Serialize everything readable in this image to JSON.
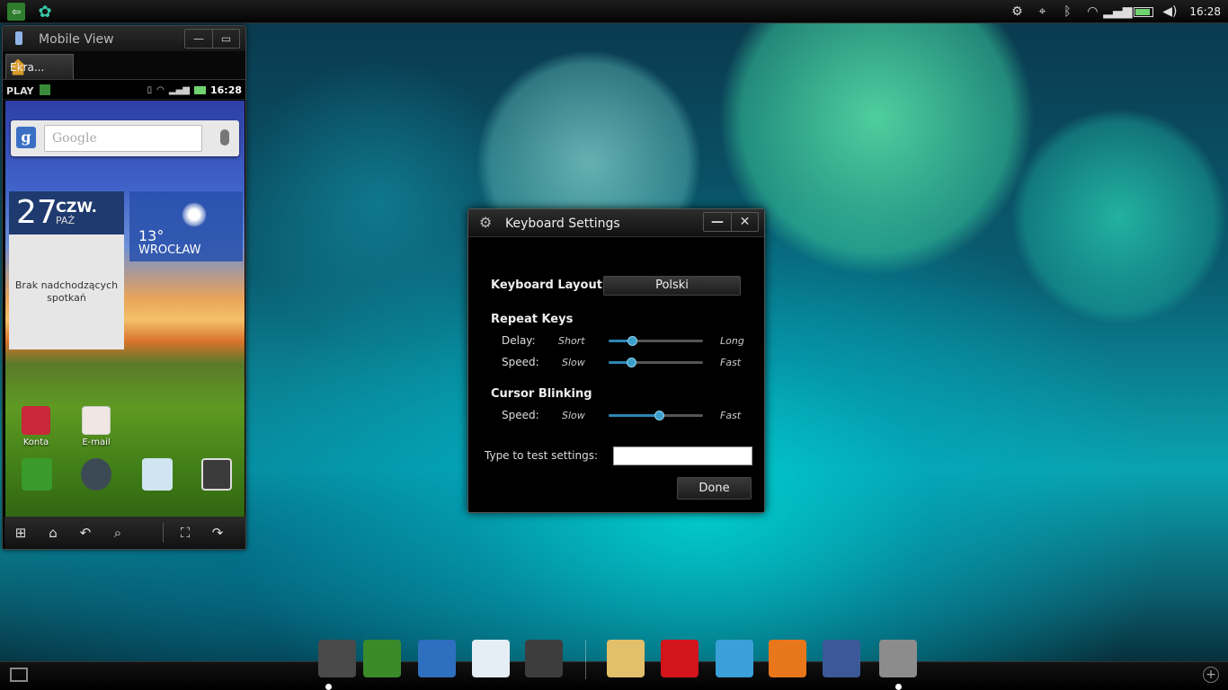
{
  "topbar": {
    "clock": "16:28"
  },
  "mobile_view": {
    "title": "Mobile View",
    "tab_label": "Ekra...",
    "phone_status": {
      "carrier": "PLAY",
      "time": "16:28"
    },
    "search": {
      "placeholder": "Google",
      "logo": "g"
    },
    "date_widget": {
      "day": "27",
      "month_line1": "CZW.",
      "month_line2": "PAŹ",
      "agenda_text": "Brak nadchodzących spotkań"
    },
    "weather": {
      "temp": "13°",
      "city": "WROCŁAW"
    },
    "apps": [
      {
        "label": "Konta"
      },
      {
        "label": "E-mail"
      }
    ]
  },
  "dialog": {
    "title": "Keyboard Settings",
    "layout_label": "Keyboard Layout:",
    "layout_value": "Polski",
    "repeat_header": "Repeat Keys",
    "delay_label": "Delay:",
    "delay_min": "Short",
    "delay_max": "Long",
    "delay_value": 0.25,
    "speed_label": "Speed:",
    "speed_min": "Slow",
    "speed_max": "Fast",
    "speed_value": 0.24,
    "blink_header": "Cursor Blinking",
    "blink_speed_label": "Speed:",
    "blink_min": "Slow",
    "blink_max": "Fast",
    "blink_value": 0.53,
    "test_label": "Type to test settings:",
    "test_value": "",
    "done_label": "Done"
  },
  "dock": [
    {
      "icon": "phone-icon",
      "color": "#4a4a4a"
    },
    {
      "icon": "dialer-icon",
      "color": "#3a8a2a"
    },
    {
      "icon": "contacts-icon",
      "color": "#2f6fc0"
    },
    {
      "icon": "email-icon",
      "color": "#e6eef5"
    },
    {
      "icon": "hd-video-icon",
      "color": "#3d3d3d"
    },
    {
      "icon": "folder-icon",
      "color": "#e2bf6a"
    },
    {
      "icon": "motorola-icon",
      "color": "#d4141b"
    },
    {
      "icon": "film-icon",
      "color": "#3aa0d8"
    },
    {
      "icon": "firefox-icon",
      "color": "#e8771c"
    },
    {
      "icon": "facebook-icon",
      "color": "#3b5998"
    },
    {
      "icon": "settings-icon",
      "color": "#8c8c8c"
    }
  ]
}
